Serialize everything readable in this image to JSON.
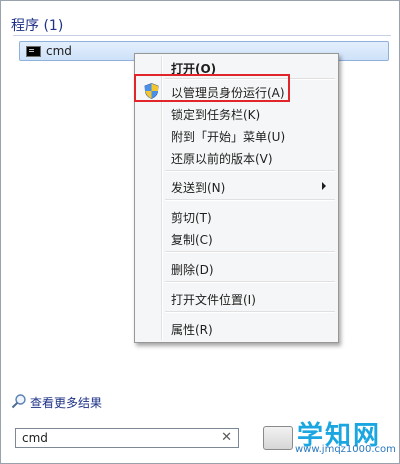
{
  "results": {
    "section_title": "程序 (1)",
    "items": [
      {
        "label": "cmd",
        "icon": "cmd-window-icon"
      }
    ]
  },
  "context_menu": {
    "items": [
      {
        "label": "打开(O)",
        "bold": true
      },
      {
        "label": "以管理员身份运行(A)",
        "icon": "uac-shield-icon",
        "highlighted": true
      },
      {
        "label": "锁定到任务栏(K)"
      },
      {
        "label": "附到「开始」菜单(U)"
      },
      {
        "label": "还原以前的版本(V)"
      },
      {
        "label": "发送到(N)",
        "submenu": true
      },
      {
        "label": "剪切(T)"
      },
      {
        "label": "复制(C)"
      },
      {
        "label": "删除(D)"
      },
      {
        "label": "打开文件位置(I)"
      },
      {
        "label": "属性(R)"
      }
    ]
  },
  "more_results": {
    "label": "查看更多结果"
  },
  "search": {
    "value": "cmd",
    "clear_glyph": "✕"
  },
  "watermark": {
    "title": "学知网",
    "url": "www.jmqz1000.com"
  },
  "colors": {
    "highlight_box": "#e1262b",
    "link": "#1e3287",
    "selection": "#cde1f8"
  }
}
